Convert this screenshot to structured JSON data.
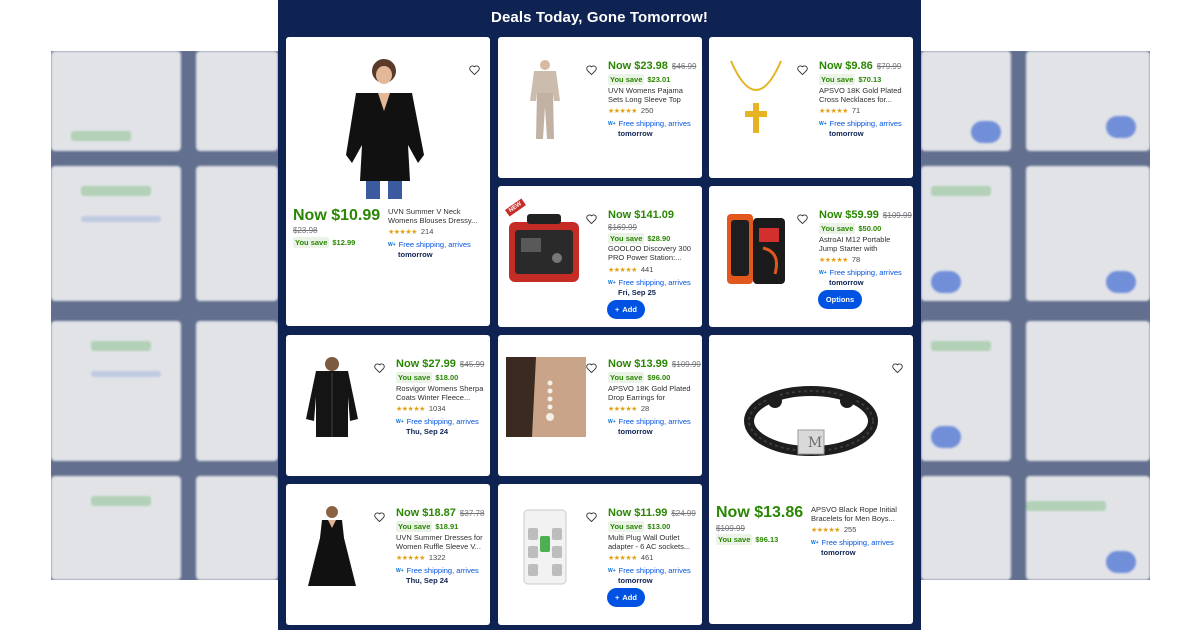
{
  "banner": {
    "title": "Deals Today, Gone Tomorrow!"
  },
  "colors": {
    "navy": "#0e2352",
    "green": "#2a8703",
    "blue": "#0053e2",
    "star": "#e3a117"
  },
  "products": [
    {
      "id": "top-blouse",
      "now": "Now $10.99",
      "was": "$23.98",
      "save_label": "You save",
      "save_amount": "$12.99",
      "title": "UVN Summer V Neck Womens Blouses Dressy...",
      "rating_count": "214",
      "shipping": "Free shipping, arrives",
      "arrives": "tomorrow",
      "icon": "black-blouse-image"
    },
    {
      "id": "pajama-set",
      "now": "Now $23.98",
      "was": "$46.99",
      "save_label": "You save",
      "save_amount": "$23.01",
      "title": "UVN Womens Pajama Sets Long Sleeve Top and...",
      "rating_count": "250",
      "shipping": "Free shipping, arrives",
      "arrives": "tomorrow"
    },
    {
      "id": "cross-necklace",
      "now": "Now $9.86",
      "was": "$79.99",
      "save_label": "You save",
      "save_amount": "$70.13",
      "title": "APSVO 18K Gold Plated Cross Necklaces for...",
      "rating_count": "71",
      "shipping": "Free shipping, arrives",
      "arrives": "tomorrow"
    },
    {
      "id": "power-station",
      "badge": "NEW",
      "now": "Now $141.09",
      "was": "$169.99",
      "save_label": "You save",
      "save_amount": "$28.90",
      "title": "GOOLOO Discovery 300 PRO Power Station:...",
      "rating_count": "441",
      "shipping": "Free shipping, arrives",
      "arrives": "Fri, Sep 25",
      "button": "Add"
    },
    {
      "id": "jump-starter",
      "now": "Now $59.99",
      "was": "$109.99",
      "save_label": "You save",
      "save_amount": "$50.00",
      "title": "AstroAI M12 Portable Jump Starter with 150PSI...",
      "rating_count": "78",
      "shipping": "Free shipping, arrives",
      "arrives": "tomorrow",
      "button": "Options"
    },
    {
      "id": "sherpa-coat",
      "now": "Now $27.99",
      "was": "$45.99",
      "save_label": "You save",
      "save_amount": "$18.00",
      "title": "Rosvigor Womens Sherpa Coats Winter Fleece...",
      "rating_count": "1034",
      "shipping": "Free shipping, arrives",
      "arrives": "Thu, Sep 24"
    },
    {
      "id": "drop-earrings",
      "now": "Now $13.99",
      "was": "$109.99",
      "save_label": "You save",
      "save_amount": "$96.00",
      "title": "APSVO 18K Gold Plated Drop Earrings for Women...",
      "rating_count": "28",
      "shipping": "Free shipping, arrives",
      "arrives": "tomorrow"
    },
    {
      "id": "rope-bracelet",
      "now": "Now $13.86",
      "was": "$109.99",
      "save_label": "You save",
      "save_amount": "$96.13",
      "title": "APSVO Black Rope Initial Bracelets for Men Boys...",
      "rating_count": "255",
      "shipping": "Free shipping, arrives",
      "arrives": "tomorrow",
      "initial": "M"
    },
    {
      "id": "summer-dress",
      "now": "Now $18.87",
      "was": "$37.78",
      "save_label": "You save",
      "save_amount": "$18.91",
      "title": "UVN Summer Dresses for Women Ruffle Sleeve V...",
      "rating_count": "1322",
      "shipping": "Free shipping, arrives",
      "arrives": "Thu, Sep 24"
    },
    {
      "id": "outlet-adapter",
      "now": "Now $11.99",
      "was": "$24.99",
      "save_label": "You save",
      "save_amount": "$13.00",
      "title": "Multi Plug Wall Outlet adapter - 6 AC sockets...",
      "rating_count": "461",
      "shipping": "Free shipping, arrives",
      "arrives": "tomorrow",
      "button": "Add"
    }
  ]
}
